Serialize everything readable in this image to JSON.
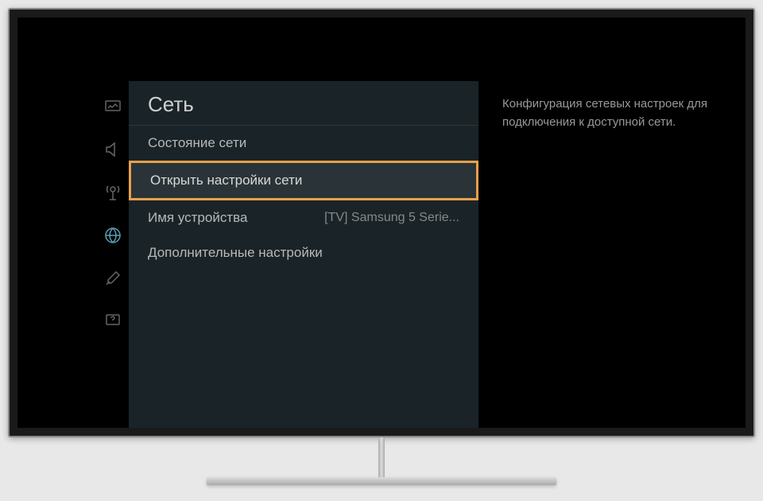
{
  "menu": {
    "title": "Сеть",
    "items": [
      {
        "label": "Состояние сети",
        "value": "",
        "highlighted": false
      },
      {
        "label": "Открыть настройки сети",
        "value": "",
        "highlighted": true
      },
      {
        "label": "Имя устройства",
        "value": "[TV] Samsung 5 Serie...",
        "highlighted": false
      },
      {
        "label": "Дополнительные настройки",
        "value": "",
        "highlighted": false
      }
    ]
  },
  "sidebar": {
    "icons": [
      {
        "name": "picture-icon",
        "active": false
      },
      {
        "name": "sound-icon",
        "active": false
      },
      {
        "name": "broadcast-icon",
        "active": false
      },
      {
        "name": "network-icon",
        "active": true
      },
      {
        "name": "general-icon",
        "active": false
      },
      {
        "name": "support-icon",
        "active": false
      }
    ]
  },
  "help": {
    "text": "Конфигурация сетевых настроек для подключения к доступной сети."
  }
}
